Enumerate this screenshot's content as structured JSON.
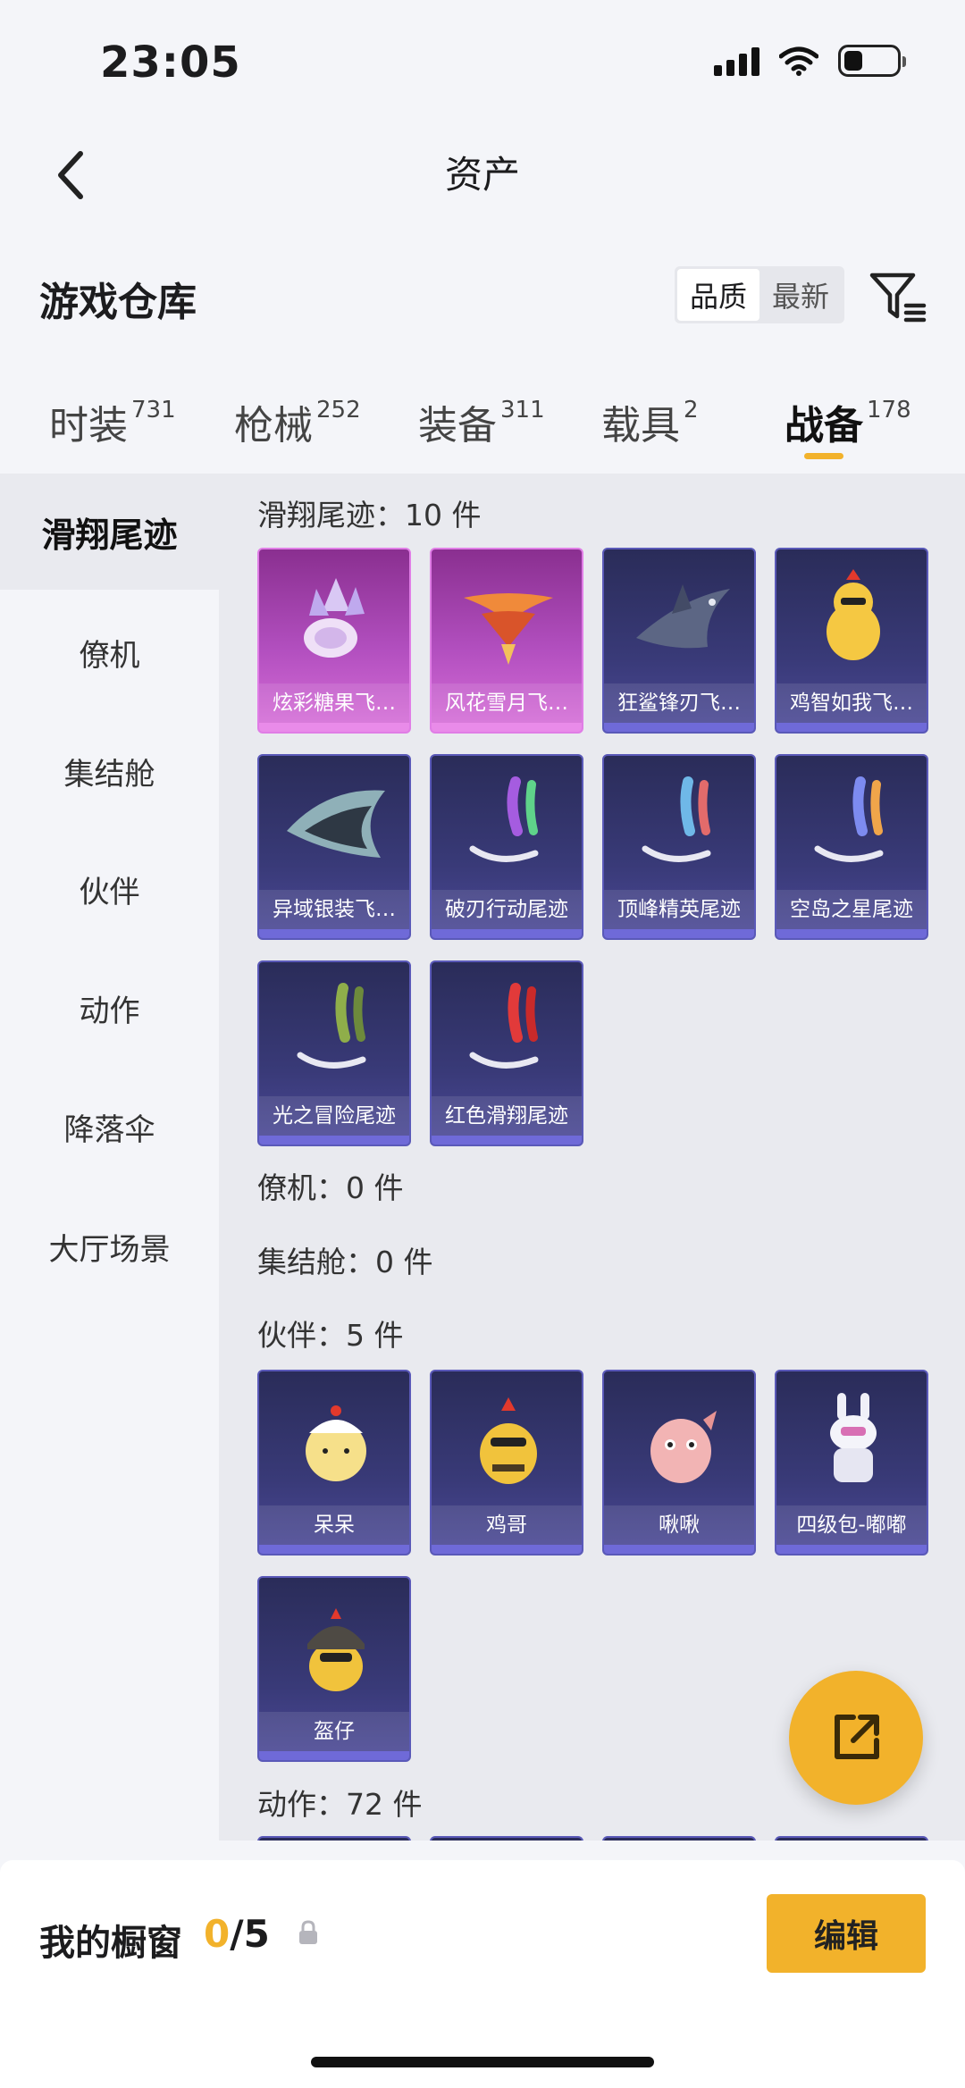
{
  "status": {
    "time": "23:05"
  },
  "nav": {
    "title": "资产",
    "back_icon": "chevron-left-icon"
  },
  "header": {
    "title": "游戏仓库",
    "sort_options": [
      "品质",
      "最新"
    ],
    "sort_selected": "品质",
    "filter_icon": "filter-icon"
  },
  "tabs": [
    {
      "label": "时装",
      "count": "731"
    },
    {
      "label": "枪械",
      "count": "252"
    },
    {
      "label": "装备",
      "count": "311"
    },
    {
      "label": "载具",
      "count": "2"
    },
    {
      "label": "战备",
      "count": "178",
      "active": true
    }
  ],
  "sidebar": {
    "items": [
      "滑翔尾迹",
      "僚机",
      "集结舱",
      "伙伴",
      "动作",
      "降落伞",
      "大厅场景"
    ],
    "active": "滑翔尾迹"
  },
  "content": {
    "sections": {
      "glide": {
        "label": "滑翔尾迹：10 件",
        "items": [
          "炫彩糖果飞…",
          "风花雪月飞…",
          "狂鲨锋刃飞…",
          "鸡智如我飞…",
          "异域银装飞…",
          "破刃行动尾迹",
          "顶峰精英尾迹",
          "空岛之星尾迹",
          "光之冒险尾迹",
          "红色滑翔尾迹"
        ]
      },
      "wingman": {
        "label": "僚机：0 件"
      },
      "rally": {
        "label": "集结舱：0 件"
      },
      "partner": {
        "label": "伙伴：5 件",
        "items": [
          "呆呆",
          "鸡哥",
          "啾啾",
          "四级包-嘟嘟",
          "盔仔"
        ]
      },
      "emote": {
        "label": "动作：72 件"
      }
    }
  },
  "fab": {
    "icon": "share-external-icon"
  },
  "showcase": {
    "label": "我的橱窗",
    "current": "0",
    "total": "/5",
    "lock_icon": "lock-icon",
    "edit_label": "编辑"
  },
  "colors": {
    "accent": "#f2b22b",
    "card_dark": "#393a78",
    "card_pink": "#b24fbf"
  }
}
